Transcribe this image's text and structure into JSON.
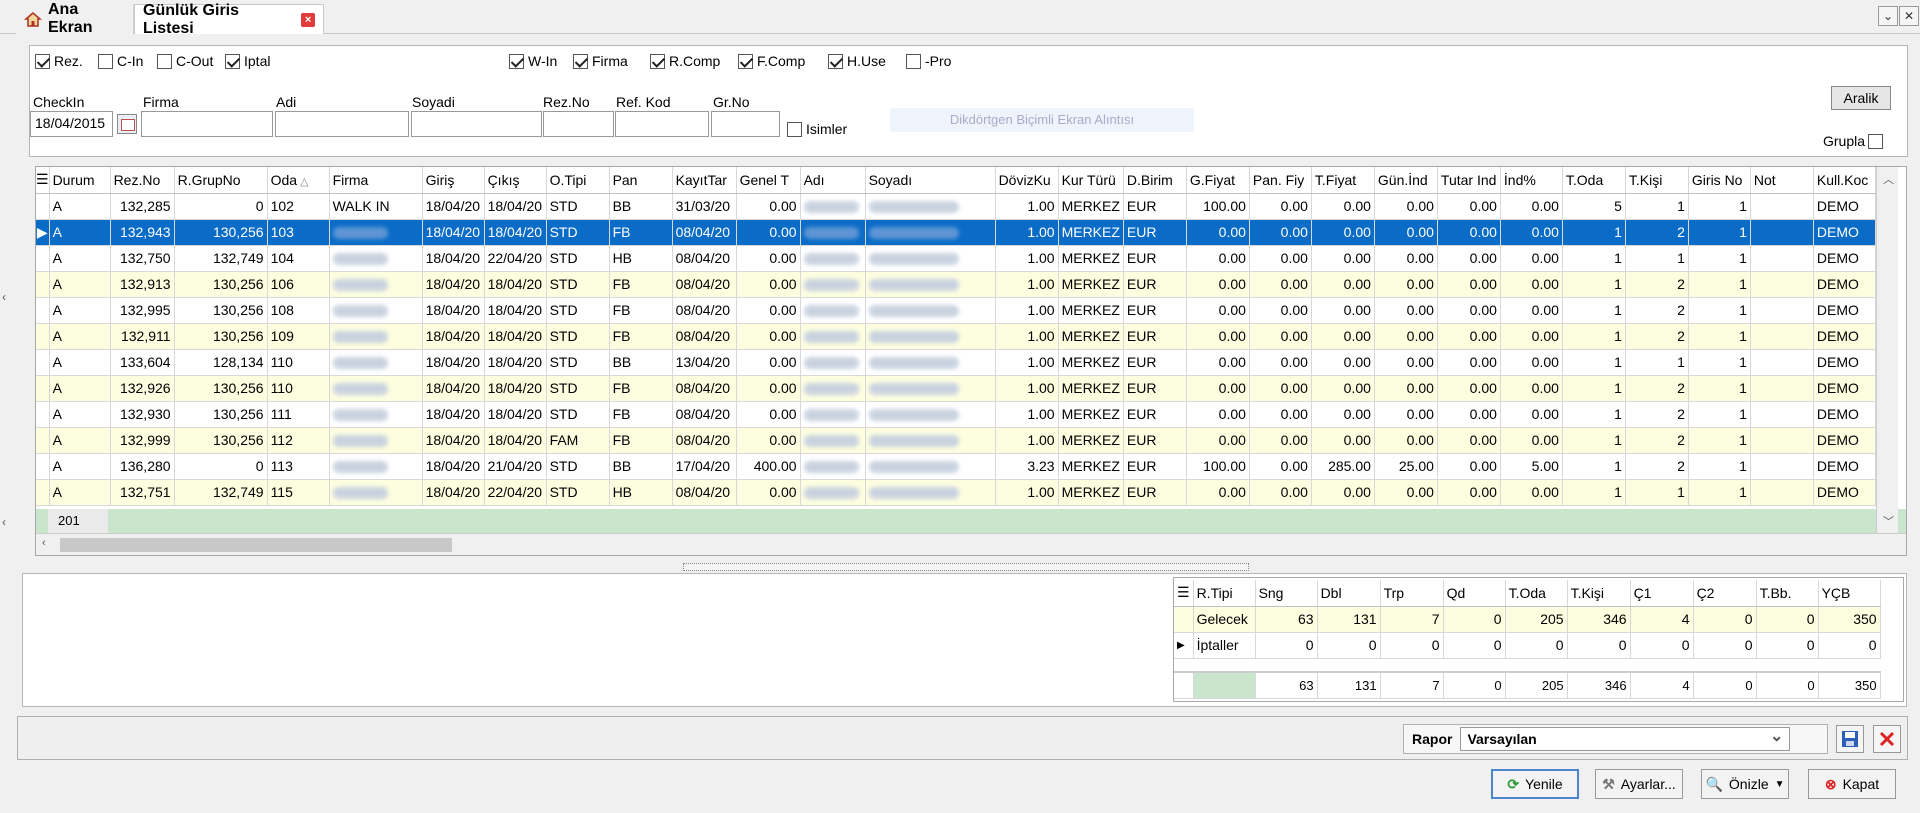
{
  "tabs": [
    {
      "label": "Ana Ekran"
    },
    {
      "label": "Günlük Giris Listesi"
    }
  ],
  "filters": {
    "row1": [
      {
        "label": "Rez.",
        "checked": true
      },
      {
        "label": "C-In",
        "checked": false
      },
      {
        "label": "C-Out",
        "checked": false
      },
      {
        "label": "Iptal",
        "checked": true
      }
    ],
    "row1b": [
      {
        "label": "W-In",
        "checked": true
      },
      {
        "label": "Firma",
        "checked": true
      },
      {
        "label": "R.Comp",
        "checked": true
      },
      {
        "label": "F.Comp",
        "checked": true
      },
      {
        "label": "H.Use",
        "checked": true
      },
      {
        "label": "-Pro",
        "checked": false
      }
    ],
    "fields": {
      "checkin_label": "CheckIn",
      "checkin_value": "18/04/2015",
      "firma_label": "Firma",
      "adi_label": "Adi",
      "soyadi_label": "Soyadi",
      "rezno_label": "Rez.No",
      "refkod_label": "Ref. Kod",
      "grno_label": "Gr.No"
    },
    "isimler_label": "Isimler",
    "aralik_label": "Aralik",
    "grupla_label": "Grupla",
    "snip_text": "Dikdörtgen Biçimli Ekran Alıntısı"
  },
  "grid": {
    "columns": [
      "Durum",
      "Rez.No",
      "R.GrupNo",
      "Oda",
      "Firma",
      "Giriş",
      "Çıkış",
      "O.Tipi",
      "Pan",
      "KayıtTar",
      "Genel T",
      "Adı",
      "Soyadı",
      "DövizKu",
      "Kur Türü",
      "D.Birim",
      "G.Fiyat",
      "Pan. Fiy",
      "T.Fiyat",
      "Gün.İnd",
      "Tutar Ind",
      "İnd%",
      "T.Oda",
      "T.Kişi",
      "Giris No",
      "Not",
      "Kull.Koc"
    ],
    "rows": [
      {
        "durum": "A",
        "rezno": "132,285",
        "grupno": "0",
        "oda": "102",
        "firma": "WALK IN",
        "giris": "18/04/20",
        "cikis": "18/04/20",
        "otipi": "STD",
        "pan": "BB",
        "kayit": "31/03/20",
        "genel": "0.00",
        "doviz": "1.00",
        "kur": "MERKEZ",
        "birim": "EUR",
        "gfiyat": "100.00",
        "panfiy": "0.00",
        "tfiyat": "0.00",
        "gunind": "0.00",
        "tutarind": "0.00",
        "indp": "0.00",
        "toda": "5",
        "tkisi": "1",
        "girisno": "1",
        "not": "",
        "kull": "DEMO"
      },
      {
        "durum": "A",
        "rezno": "132,943",
        "grupno": "130,256",
        "oda": "103",
        "firma": "",
        "giris": "18/04/20",
        "cikis": "18/04/20",
        "otipi": "STD",
        "pan": "FB",
        "kayit": "08/04/20",
        "genel": "0.00",
        "doviz": "1.00",
        "kur": "MERKEZ",
        "birim": "EUR",
        "gfiyat": "0.00",
        "panfiy": "0.00",
        "tfiyat": "0.00",
        "gunind": "0.00",
        "tutarind": "0.00",
        "indp": "0.00",
        "toda": "1",
        "tkisi": "2",
        "girisno": "1",
        "not": "",
        "kull": "DEMO"
      },
      {
        "durum": "A",
        "rezno": "132,750",
        "grupno": "132,749",
        "oda": "104",
        "firma": "",
        "giris": "18/04/20",
        "cikis": "22/04/20",
        "otipi": "STD",
        "pan": "HB",
        "kayit": "08/04/20",
        "genel": "0.00",
        "doviz": "1.00",
        "kur": "MERKEZ",
        "birim": "EUR",
        "gfiyat": "0.00",
        "panfiy": "0.00",
        "tfiyat": "0.00",
        "gunind": "0.00",
        "tutarind": "0.00",
        "indp": "0.00",
        "toda": "1",
        "tkisi": "1",
        "girisno": "1",
        "not": "",
        "kull": "DEMO"
      },
      {
        "durum": "A",
        "rezno": "132,913",
        "grupno": "130,256",
        "oda": "106",
        "firma": "",
        "giris": "18/04/20",
        "cikis": "18/04/20",
        "otipi": "STD",
        "pan": "FB",
        "kayit": "08/04/20",
        "genel": "0.00",
        "doviz": "1.00",
        "kur": "MERKEZ",
        "birim": "EUR",
        "gfiyat": "0.00",
        "panfiy": "0.00",
        "tfiyat": "0.00",
        "gunind": "0.00",
        "tutarind": "0.00",
        "indp": "0.00",
        "toda": "1",
        "tkisi": "2",
        "girisno": "1",
        "not": "",
        "kull": "DEMO"
      },
      {
        "durum": "A",
        "rezno": "132,995",
        "grupno": "130,256",
        "oda": "108",
        "firma": "",
        "giris": "18/04/20",
        "cikis": "18/04/20",
        "otipi": "STD",
        "pan": "FB",
        "kayit": "08/04/20",
        "genel": "0.00",
        "doviz": "1.00",
        "kur": "MERKEZ",
        "birim": "EUR",
        "gfiyat": "0.00",
        "panfiy": "0.00",
        "tfiyat": "0.00",
        "gunind": "0.00",
        "tutarind": "0.00",
        "indp": "0.00",
        "toda": "1",
        "tkisi": "2",
        "girisno": "1",
        "not": "",
        "kull": "DEMO"
      },
      {
        "durum": "A",
        "rezno": "132,911",
        "grupno": "130,256",
        "oda": "109",
        "firma": "",
        "giris": "18/04/20",
        "cikis": "18/04/20",
        "otipi": "STD",
        "pan": "FB",
        "kayit": "08/04/20",
        "genel": "0.00",
        "doviz": "1.00",
        "kur": "MERKEZ",
        "birim": "EUR",
        "gfiyat": "0.00",
        "panfiy": "0.00",
        "tfiyat": "0.00",
        "gunind": "0.00",
        "tutarind": "0.00",
        "indp": "0.00",
        "toda": "1",
        "tkisi": "2",
        "girisno": "1",
        "not": "",
        "kull": "DEMO"
      },
      {
        "durum": "A",
        "rezno": "133,604",
        "grupno": "128,134",
        "oda": "110",
        "firma": "",
        "giris": "18/04/20",
        "cikis": "18/04/20",
        "otipi": "STD",
        "pan": "BB",
        "kayit": "13/04/20",
        "genel": "0.00",
        "doviz": "1.00",
        "kur": "MERKEZ",
        "birim": "EUR",
        "gfiyat": "0.00",
        "panfiy": "0.00",
        "tfiyat": "0.00",
        "gunind": "0.00",
        "tutarind": "0.00",
        "indp": "0.00",
        "toda": "1",
        "tkisi": "1",
        "girisno": "1",
        "not": "",
        "kull": "DEMO"
      },
      {
        "durum": "A",
        "rezno": "132,926",
        "grupno": "130,256",
        "oda": "110",
        "firma": "",
        "giris": "18/04/20",
        "cikis": "18/04/20",
        "otipi": "STD",
        "pan": "FB",
        "kayit": "08/04/20",
        "genel": "0.00",
        "doviz": "1.00",
        "kur": "MERKEZ",
        "birim": "EUR",
        "gfiyat": "0.00",
        "panfiy": "0.00",
        "tfiyat": "0.00",
        "gunind": "0.00",
        "tutarind": "0.00",
        "indp": "0.00",
        "toda": "1",
        "tkisi": "2",
        "girisno": "1",
        "not": "",
        "kull": "DEMO"
      },
      {
        "durum": "A",
        "rezno": "132,930",
        "grupno": "130,256",
        "oda": "111",
        "firma": "",
        "giris": "18/04/20",
        "cikis": "18/04/20",
        "otipi": "STD",
        "pan": "FB",
        "kayit": "08/04/20",
        "genel": "0.00",
        "doviz": "1.00",
        "kur": "MERKEZ",
        "birim": "EUR",
        "gfiyat": "0.00",
        "panfiy": "0.00",
        "tfiyat": "0.00",
        "gunind": "0.00",
        "tutarind": "0.00",
        "indp": "0.00",
        "toda": "1",
        "tkisi": "2",
        "girisno": "1",
        "not": "",
        "kull": "DEMO"
      },
      {
        "durum": "A",
        "rezno": "132,999",
        "grupno": "130,256",
        "oda": "112",
        "firma": "",
        "giris": "18/04/20",
        "cikis": "18/04/20",
        "otipi": "FAM",
        "pan": "FB",
        "kayit": "08/04/20",
        "genel": "0.00",
        "doviz": "1.00",
        "kur": "MERKEZ",
        "birim": "EUR",
        "gfiyat": "0.00",
        "panfiy": "0.00",
        "tfiyat": "0.00",
        "gunind": "0.00",
        "tutarind": "0.00",
        "indp": "0.00",
        "toda": "1",
        "tkisi": "2",
        "girisno": "1",
        "not": "",
        "kull": "DEMO"
      },
      {
        "durum": "A",
        "rezno": "136,280",
        "grupno": "0",
        "oda": "113",
        "firma": "",
        "giris": "18/04/20",
        "cikis": "21/04/20",
        "otipi": "STD",
        "pan": "BB",
        "kayit": "17/04/20",
        "genel": "400.00",
        "doviz": "3.23",
        "kur": "MERKEZ",
        "birim": "EUR",
        "gfiyat": "100.00",
        "panfiy": "0.00",
        "tfiyat": "285.00",
        "gunind": "25.00",
        "tutarind": "0.00",
        "indp": "5.00",
        "toda": "1",
        "tkisi": "2",
        "girisno": "1",
        "not": "",
        "kull": "DEMO"
      },
      {
        "durum": "A",
        "rezno": "132,751",
        "grupno": "132,749",
        "oda": "115",
        "firma": "",
        "giris": "18/04/20",
        "cikis": "22/04/20",
        "otipi": "STD",
        "pan": "HB",
        "kayit": "08/04/20",
        "genel": "0.00",
        "doviz": "1.00",
        "kur": "MERKEZ",
        "birim": "EUR",
        "gfiyat": "0.00",
        "panfiy": "0.00",
        "tfiyat": "0.00",
        "gunind": "0.00",
        "tutarind": "0.00",
        "indp": "0.00",
        "toda": "1",
        "tkisi": "1",
        "girisno": "1",
        "not": "",
        "kull": "DEMO"
      }
    ],
    "footer_count": "201"
  },
  "summary": {
    "columns": [
      "R.Tipi",
      "Sng",
      "Dbl",
      "Trp",
      "Qd",
      "T.Oda",
      "T.Kişi",
      "Ç1",
      "Ç2",
      "T.Bb.",
      "YÇB"
    ],
    "rows": [
      [
        "Gelecek",
        "63",
        "131",
        "7",
        "0",
        "205",
        "346",
        "4",
        "0",
        "0",
        "350"
      ],
      [
        "İptaller",
        "0",
        "0",
        "0",
        "0",
        "0",
        "0",
        "0",
        "0",
        "0",
        "0"
      ]
    ],
    "totals": [
      "",
      "63",
      "131",
      "7",
      "0",
      "205",
      "346",
      "4",
      "0",
      "0",
      "350"
    ]
  },
  "rapor": {
    "label": "Rapor",
    "value": "Varsayılan"
  },
  "buttons": {
    "yenile": "Yenile",
    "ayarlar": "Ayarlar...",
    "onizle": "Önizle",
    "kapat": "Kapat"
  }
}
